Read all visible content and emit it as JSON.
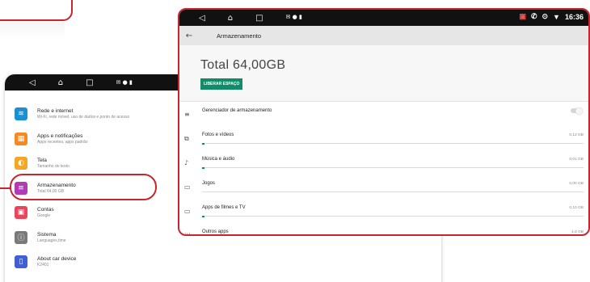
{
  "left_screen": {
    "items": [
      {
        "title": "Rede e internet",
        "subtitle": "Wi-Fi, rede móvel, uso de dados e ponto de acesso",
        "icon": "wifi-icon",
        "color": "#1a8fd6"
      },
      {
        "title": "Apps e notificações",
        "subtitle": "Apps recentes, apps padrão",
        "icon": "apps-icon",
        "color": "#f58a1f"
      },
      {
        "title": "Tela",
        "subtitle": "Tamanho do texto",
        "icon": "brightness-icon",
        "color": "#f5a623"
      },
      {
        "title": "Armazenamento",
        "subtitle": "Total 64,00 GB",
        "icon": "storage-icon",
        "color": "#b33ab7"
      },
      {
        "title": "Contas",
        "subtitle": "Google",
        "icon": "accounts-icon",
        "color": "#e8465b"
      },
      {
        "title": "Sistema",
        "subtitle": "Languages,time",
        "icon": "info-icon",
        "color": "#7a7a7a"
      },
      {
        "title": "About car device",
        "subtitle": "K2401",
        "icon": "device-icon",
        "color": "#3f5fd6"
      }
    ]
  },
  "right_screen": {
    "time": "16:36",
    "title": "Armazenamento",
    "total": "Total  64,00GB",
    "free_button": "LIBERAR ESPAÇO",
    "manager_label": "Gerenciador de armazenamento",
    "categories": [
      {
        "label": "Fotos e vídeos",
        "value": "0,12 GB",
        "icon": "photo-icon",
        "fill": 0.002
      },
      {
        "label": "Música e áudio",
        "value": "0,01 GB",
        "icon": "music-icon",
        "fill": 0.0002
      },
      {
        "label": "Jogos",
        "value": "0,00 GB",
        "icon": "gamepad-icon",
        "fill": 0
      },
      {
        "label": "Apps de filmes e TV",
        "value": "0,10 GB",
        "icon": "tv-icon",
        "fill": 0.002
      },
      {
        "label": "Outros apps",
        "value": "1,6 GB",
        "icon": "grid-icon",
        "fill": 0.025
      }
    ]
  },
  "colors": {
    "highlight": "#c8262c",
    "accent": "#138a68"
  }
}
